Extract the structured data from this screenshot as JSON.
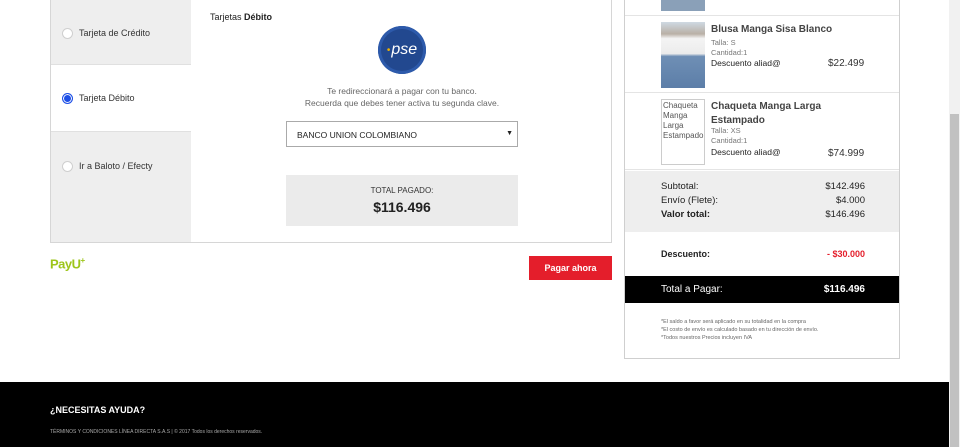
{
  "payment": {
    "methods": [
      {
        "label": "Tarjeta de Crédito",
        "selected": false
      },
      {
        "label": "Tarjeta Débito",
        "selected": true
      },
      {
        "label": "Ir a Baloto / Efecty",
        "selected": false
      }
    ],
    "detail_title_prefix": "Tarjetas",
    "detail_title_bold": "Débito",
    "logo_text": "pse",
    "redirect_line1": "Te redireccionará a pagar con tu banco.",
    "redirect_line2": "Recuerda que debes tener activa tu segunda clave.",
    "bank_selected": "BANCO UNION COLOMBIANO",
    "total_label": "TOTAL PAGADO:",
    "total_value": "$116.496"
  },
  "payu_logo": "PayU",
  "pay_button": "Pagar ahora",
  "summary": {
    "items": [
      {
        "name": "Blusa Manga Sisa Blanco",
        "size": "Talla: S",
        "qty": "Cantidad:1",
        "discount_label": "Descuento aliad@",
        "price": "$22.499",
        "image_alt": ""
      },
      {
        "name": "Chaqueta Manga Larga Estampado",
        "size": "Talla: XS",
        "qty": "Cantidad:1",
        "discount_label": "Descuento aliad@",
        "price": "$74.999",
        "image_alt": "Chaqueta Manga Larga Estampado"
      }
    ],
    "subtotal_label": "Subtotal:",
    "subtotal_value": "$142.496",
    "shipping_label": "Envío (Flete):",
    "shipping_value": "$4.000",
    "total_value_label": "Valor total:",
    "total_value_value": "$146.496",
    "discount_label": "Descuento:",
    "discount_value": "- $30.000",
    "grand_label": "Total a Pagar:",
    "grand_value": "$116.496",
    "notes": [
      "*El saldo a favor será aplicado en su totalidad en la compra",
      "*El costo de envío es calculado basado en tu dirección de envío.",
      "*Todos nuestros Precios incluyen IVA"
    ]
  },
  "footer": {
    "help": "¿NECESITAS AYUDA?",
    "legal": "TÉRMINOS Y CONDICIONES LÍNEA DIRECTA S.A.S  |  © 2017 Todos los derechos reservados."
  },
  "colors": {
    "accent_red": "#e41e2b",
    "radio_blue": "#1d4fe6",
    "payu_green": "#9dc51b",
    "pse_blue": "#22488f"
  },
  "icons": [
    "radio-icon",
    "pse-logo",
    "dropdown-arrow-icon",
    "payu-logo"
  ]
}
